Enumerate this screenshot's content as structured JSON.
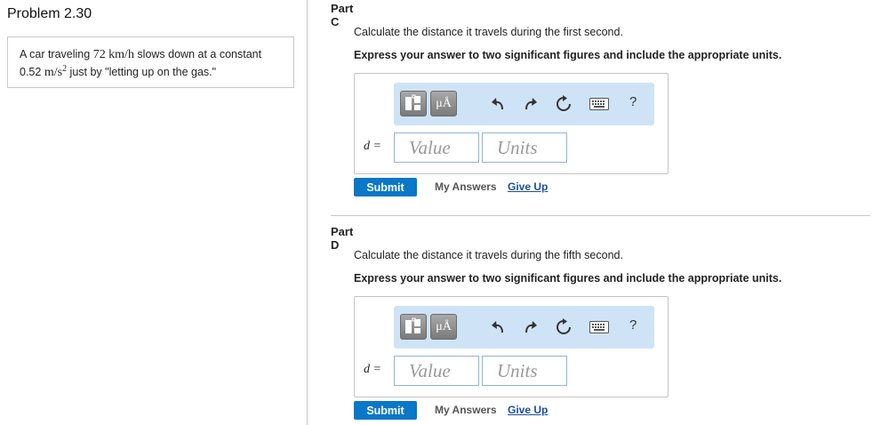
{
  "problem": {
    "title": "Problem 2.30",
    "text_1": "A car traveling ",
    "speed_value": "72",
    "speed_unit": "km/h",
    "text_2": " slows down at a constant",
    "accel_value": "0.52",
    "accel_unit": "m/s",
    "accel_exp": "2",
    "text_3": " just by \"letting up on the gas.\""
  },
  "parts": [
    {
      "title": "Part C",
      "question": "Calculate the distance it travels during the first second.",
      "instruction": "Express your answer to two significant figures and include the appropriate units.",
      "variable_label": "d =",
      "value_placeholder": "Value",
      "units_placeholder": "Units",
      "submit_label": "Submit",
      "my_answers_label": "My Answers",
      "give_up_label": "Give Up",
      "toolbar": {
        "units_icon_text": "μÅ",
        "help_label": "?"
      }
    },
    {
      "title": "Part D",
      "question": "Calculate the distance it travels during the fifth second.",
      "instruction": "Express your answer to two significant figures and include the appropriate units.",
      "variable_label": "d =",
      "value_placeholder": "Value",
      "units_placeholder": "Units",
      "submit_label": "Submit",
      "my_answers_label": "My Answers",
      "give_up_label": "Give Up",
      "toolbar": {
        "units_icon_text": "μÅ",
        "help_label": "?"
      }
    }
  ],
  "icons": [
    "templates-icon",
    "units-icon",
    "undo-icon",
    "redo-icon",
    "reset-icon",
    "keyboard-icon",
    "help-icon"
  ],
  "colors": {
    "submit": "#0a77c7",
    "toolbar_bg": "#cfe3f6",
    "link": "#1a4ea0",
    "field_border": "#8fb4d9"
  }
}
